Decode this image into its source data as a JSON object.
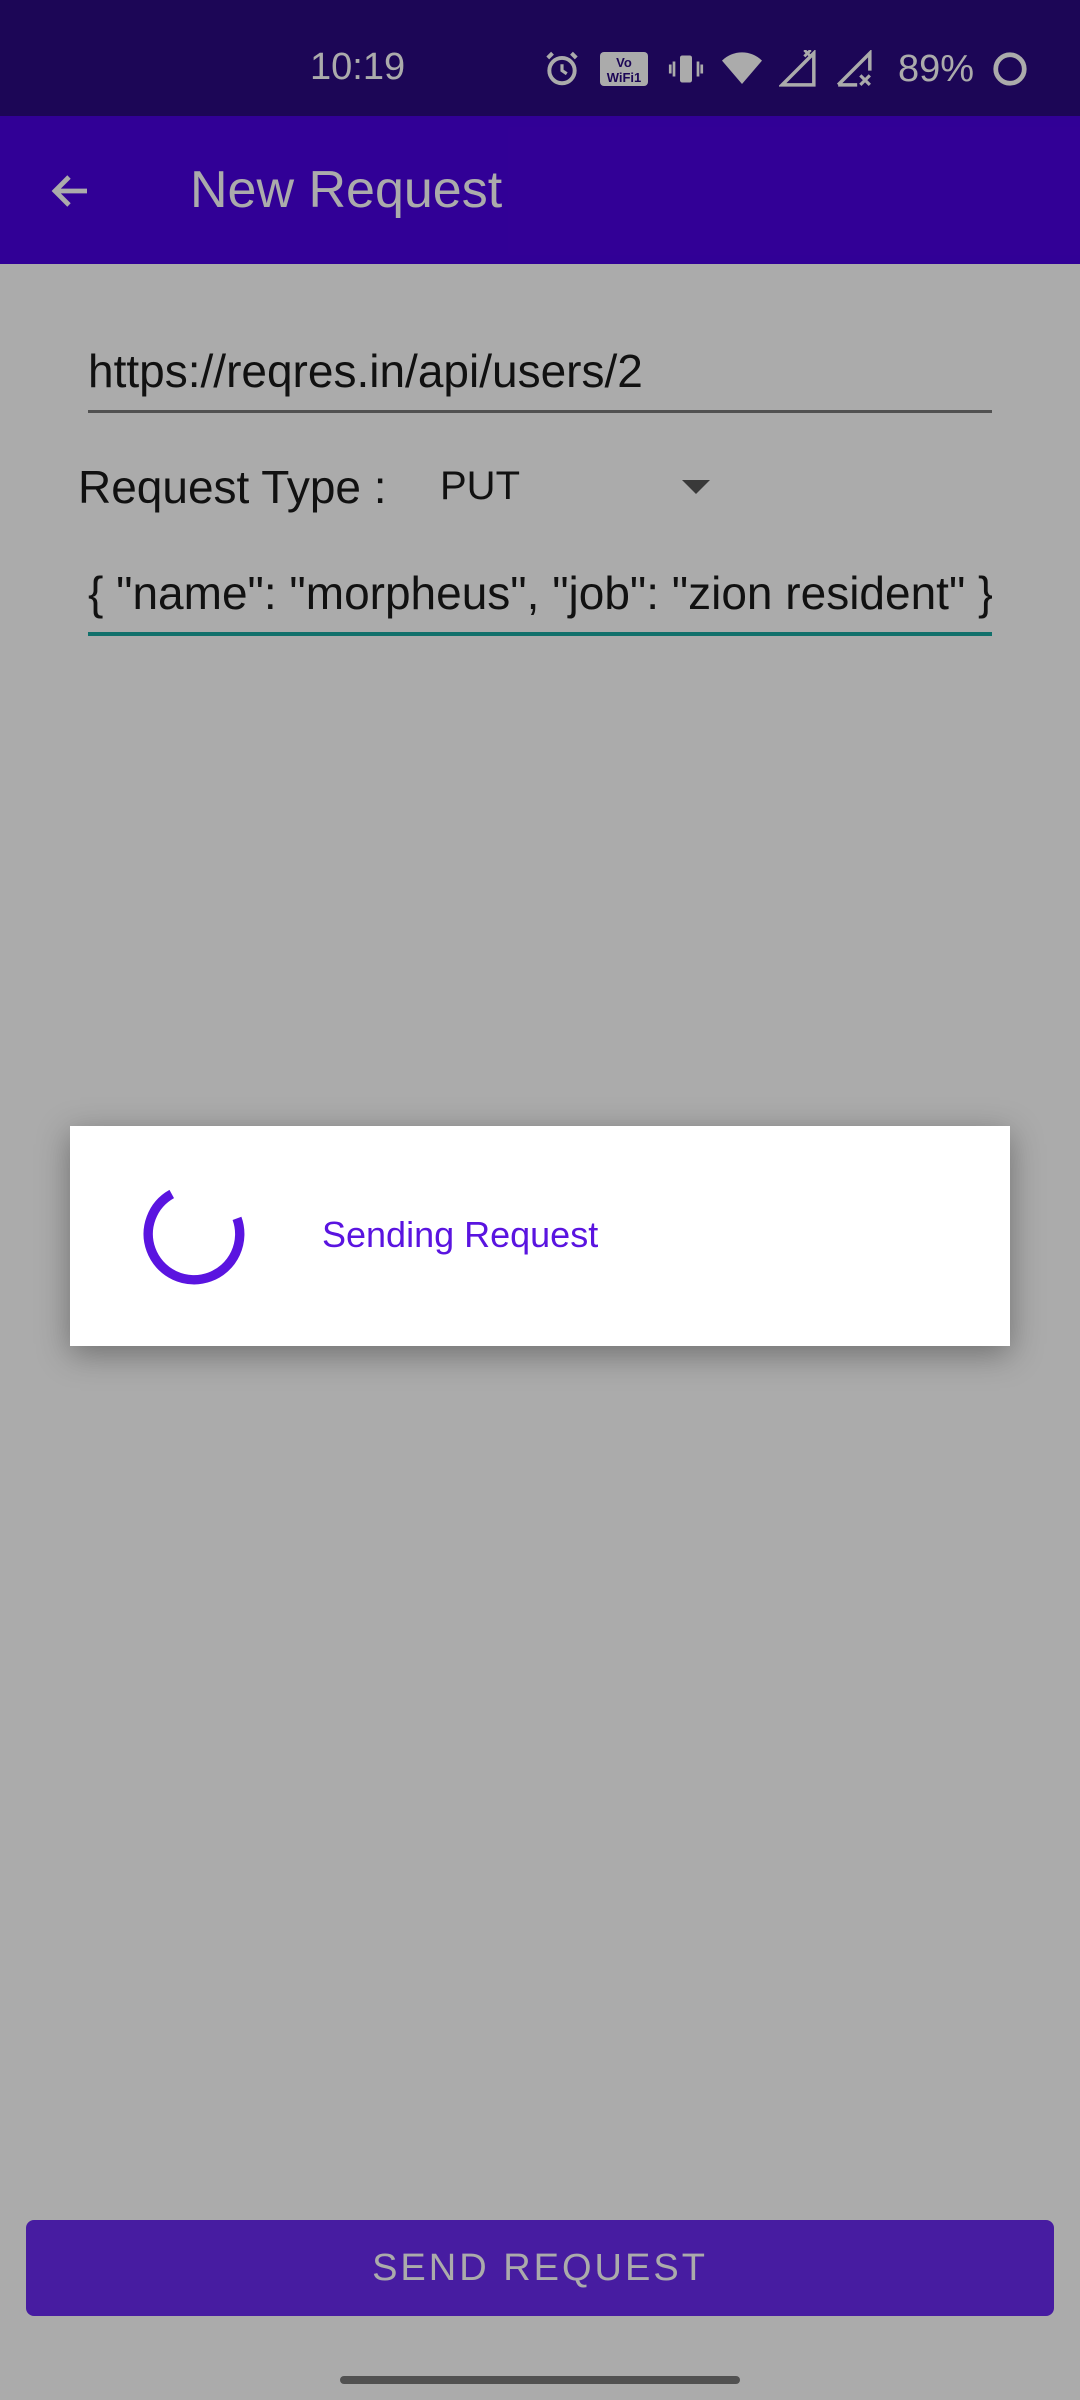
{
  "status_bar": {
    "time": "10:19",
    "battery_percent": "89%",
    "icons": [
      "alarm-icon",
      "vowifi-icon",
      "vibrate-icon",
      "wifi-icon",
      "signal-icon",
      "signal-x-icon",
      "battery-ring-icon"
    ],
    "vowifi_label": "Vo WiFi1"
  },
  "app_bar": {
    "title": "New Request",
    "back_icon": "arrow-back-icon"
  },
  "form": {
    "url_value": "https://reqres.in/api/users/2",
    "request_type_label": "Request Type :",
    "request_type_value": "PUT",
    "body_value": "{ \"name\": \"morpheus\", \"job\": \"zion resident\" }"
  },
  "dialog": {
    "message": "Sending Request"
  },
  "actions": {
    "send_label": "SEND REQUEST"
  },
  "colors": {
    "status_bar": "#2a0a80",
    "app_bar": "#4a00e0",
    "accent": "#5a14e0",
    "focus_underline": "#1aa8a0"
  }
}
